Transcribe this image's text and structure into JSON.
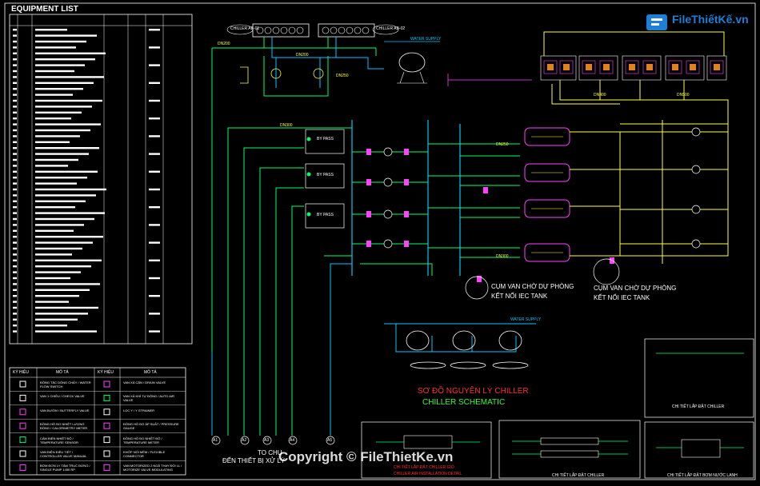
{
  "equipment_list": {
    "title": "EQUIPMENT LIST"
  },
  "legend": {
    "header_symbol": "KÝ HIỆU",
    "header_desc": "MÔ TẢ",
    "left_items": [
      "ĐỒNG TẮC DÒNG CHẢY / WATER FLOW SWITCH",
      "VAN 1 CHIỀU / CHECK VALVE",
      "VAN BƯỚM / BUTTERFLY VALVE",
      "ĐỒNG HỒ ĐO NHIỆT LƯỢNG ĐỒNG / CALORIMETRY METER",
      "CẢM BIẾN NHIỆT ĐỘ / TEMPERATURE SENSOR",
      "VAN ĐIỆN ĐIỀU TIẾT / CONTROLLER VALVE MANUAL",
      "BƠM ĐƠN LY TÂM TRỤC ĐỨNG / SINGLE PUMP 1450 RP"
    ],
    "right_items": [
      "VAN XẢ CẶN / DRAIN VALVE",
      "VAN XẢ KHÍ TỰ ĐỘNG / AUTO AIR VALVE",
      "LỌC Y / Y STRAINER",
      "ĐỒNG HỒ ĐO ÁP SUẤT / PRESSURE GAUGE",
      "ĐỒNG HỒ ĐO NHIỆT ĐỘ / TEMPERATURE METER",
      "KHỚP NỐI MỀM / FLEXIBLE CONNECTOR",
      "VAN MOTORIZED 2 NGÃ THAY ĐỔI LL / MOTORIZE VALVE MODULATING"
    ]
  },
  "labels": {
    "chiller_ab_01": "CHILLER AB-01",
    "chiller_ab_02": "CHILLER AB-02",
    "water_supply_top": "WATER SUPPLY",
    "water_supply_bottom": "WATER SUPPLY",
    "dn200": "DN200",
    "dn250": "DN250",
    "dn300": "DN300",
    "dn400": "DN400",
    "dn500": "DN500",
    "bypass": "BY PASS",
    "backup_valve_1": "CỤM VAN CHỜ DỰ PHÒNG",
    "backup_valve_1b": "KẾT NỐI IEC TANK",
    "backup_valve_2": "CỤM VAN CHỜ DỰ PHÒNG",
    "backup_valve_2b": "KẾT NỐI IEC TANK",
    "to_devices_1": "TO CHU",
    "to_devices_2": "ĐẾN THIẾT BỊ XỬ LÝ"
  },
  "headers": {
    "ahu": [
      "A1",
      "A2",
      "A3",
      "A4",
      "A5"
    ]
  },
  "titles": {
    "vn": "SƠ ĐỒ NGUYÊN LÝ CHILLER",
    "en": "CHILLER SCHEMATIC"
  },
  "details": {
    "detail_1": "CHI TIẾT LẮP ĐẶT CHILLER GIÓ",
    "detail_1_en": "CHILLER AIR INSTALLATION DETAIL",
    "detail_2": "CHI TIẾT LẮP ĐẶT CHILLER",
    "detail_3": "CHI TIẾT LẮP ĐẶT CHILLER",
    "detail_4": "CHI TIẾT LẮP ĐẶT BƠM NƯỚC LẠNH"
  },
  "brand": {
    "logo": "FileThiếtKế.vn",
    "watermark": "Copyright © FileThietKe.vn"
  },
  "colors": {
    "chilled": "#00c8ff",
    "supply": "#00ff66",
    "yellow": "#ffff40",
    "magenta": "#ff40ff",
    "white": "#ffffff",
    "red": "#ff3030"
  }
}
